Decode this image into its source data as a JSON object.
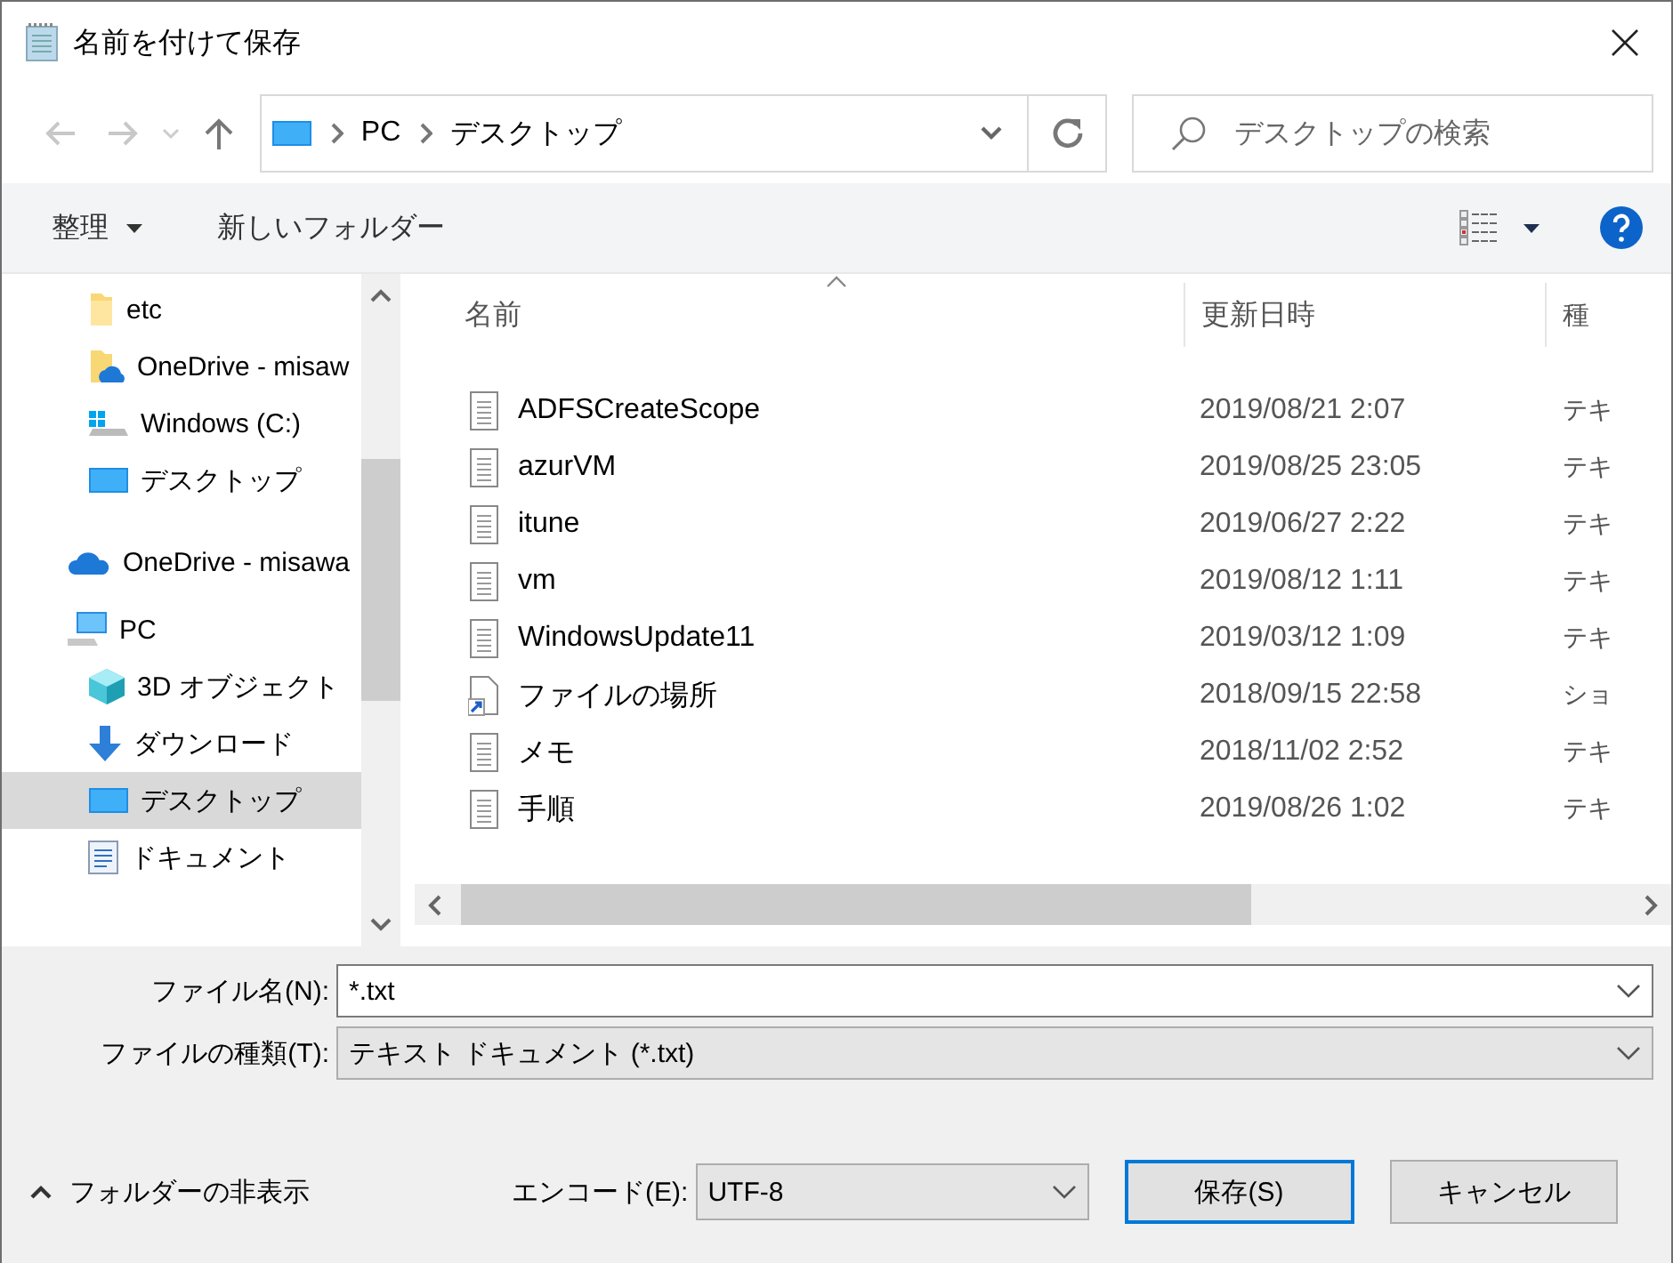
{
  "window": {
    "title": "名前を付けて保存"
  },
  "address": {
    "path": [
      "PC",
      "デスクトップ"
    ]
  },
  "search": {
    "placeholder": "デスクトップの検索"
  },
  "toolbar": {
    "organize": "整理",
    "new_folder": "新しいフォルダー"
  },
  "nav": {
    "pinned": [
      {
        "label": "etc",
        "kind": "folder",
        "selected": false
      },
      {
        "label": "OneDrive - misaw",
        "kind": "cloud-folder",
        "selected": false
      },
      {
        "label": "Windows (C:)",
        "kind": "drive",
        "selected": false
      },
      {
        "label": "デスクトップ",
        "kind": "desktop",
        "selected": false
      }
    ],
    "items": [
      {
        "label": "OneDrive - misawa",
        "kind": "cloud",
        "selected": false
      },
      {
        "label": "PC",
        "kind": "pc",
        "selected": false,
        "children": [
          {
            "label": "3D オブジェクト",
            "kind": "cube",
            "selected": false
          },
          {
            "label": "ダウンロード",
            "kind": "download",
            "selected": false
          },
          {
            "label": "デスクトップ",
            "kind": "desktop",
            "selected": true
          },
          {
            "label": "ドキュメント",
            "kind": "documents",
            "selected": false
          }
        ]
      }
    ]
  },
  "files": {
    "columns": [
      "名前",
      "更新日時",
      "種"
    ],
    "rows": [
      {
        "name": "ADFSCreateScope",
        "modified": "2019/08/21 2:07",
        "column_3": "テキ",
        "kind": "text"
      },
      {
        "name": "azurVM",
        "modified": "2019/08/25 23:05",
        "column_3": "テキ",
        "kind": "text"
      },
      {
        "name": "itune",
        "modified": "2019/06/27 2:22",
        "column_3": "テキ",
        "kind": "text"
      },
      {
        "name": "vm",
        "modified": "2019/08/12 1:11",
        "column_3": "テキ",
        "kind": "text"
      },
      {
        "name": "WindowsUpdate11",
        "modified": "2019/03/12 1:09",
        "column_3": "テキ",
        "kind": "text"
      },
      {
        "name": "ファイルの場所",
        "modified": "2018/09/15 22:58",
        "column_3": "ショ",
        "kind": "shortcut"
      },
      {
        "name": "メモ",
        "modified": "2018/11/02 2:52",
        "column_3": "テキ",
        "kind": "text"
      },
      {
        "name": "手順",
        "modified": "2019/08/26 1:02",
        "column_3": "テキ",
        "kind": "text"
      }
    ]
  },
  "file_name": {
    "label": "ファイル名(N):",
    "value": "*.txt"
  },
  "file_type": {
    "label": "ファイルの種類(T):",
    "value": "テキスト ドキュメント (*.txt)"
  },
  "hide_folders": "フォルダーの非表示",
  "encoding": {
    "label": "エンコード(E):",
    "value": "UTF-8"
  },
  "buttons": [
    {
      "label": "保存(S)",
      "kind": "primary"
    },
    {
      "label": "キャンセル",
      "kind": "default"
    }
  ]
}
